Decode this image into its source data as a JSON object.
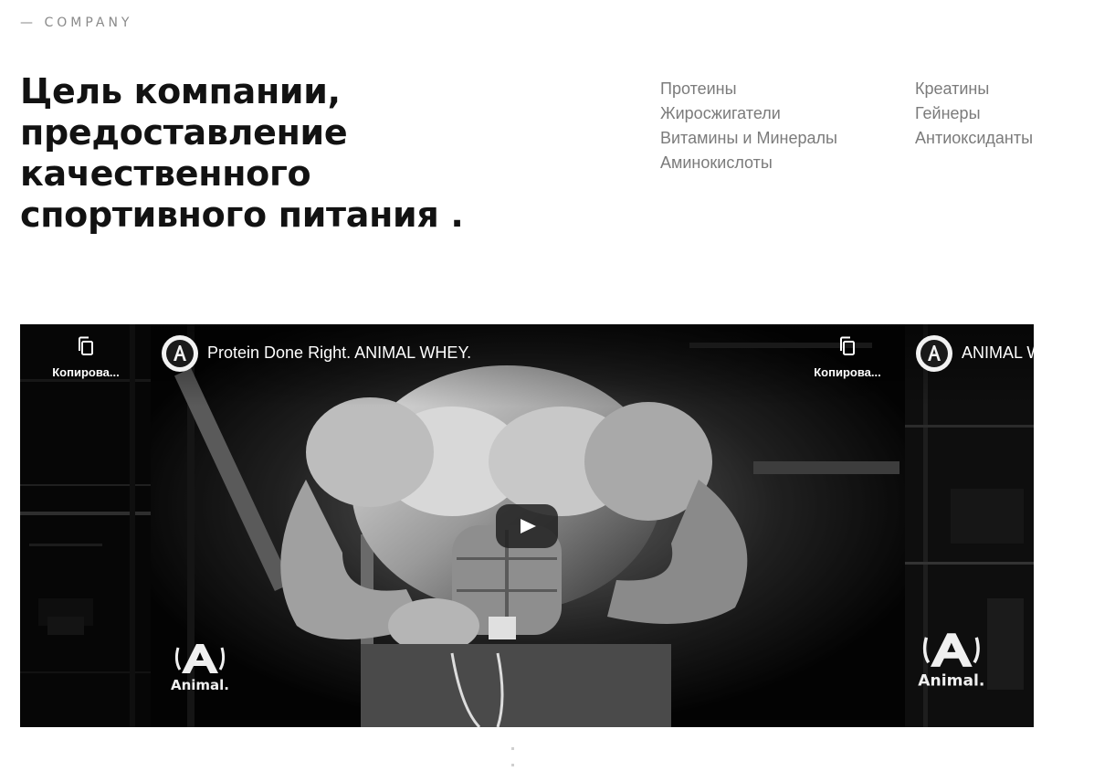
{
  "eyebrow": "— COMPANY",
  "headline": {
    "line1": "Цель компании,",
    "line2": "предоставление",
    "line3": "качественного",
    "line4": "спортивного питания ."
  },
  "categories": {
    "col1": [
      "Протеины",
      "Жиросжигатели",
      "Витамины и Минералы",
      "Аминокислоты"
    ],
    "col2": [
      "Креатины",
      "Гейнеры",
      "Антиоксиданты"
    ]
  },
  "video_carousel": {
    "slides": [
      {
        "copy_label": "Копирова...",
        "icons": [
          "copy-icon"
        ]
      },
      {
        "channel_logo": "Animal",
        "title": "Protein Done Right. ANIMAL WHEY.",
        "watermark": "Animal.",
        "icons": [
          "animal-logo-icon",
          "play-icon"
        ]
      },
      {
        "channel_logo": "Animal",
        "title": "ANIMAL W",
        "copy_label": "Копирова...",
        "watermark": "Animal.",
        "icons": [
          "animal-logo-icon",
          "copy-icon"
        ]
      }
    ]
  },
  "colors": {
    "background": "#ffffff",
    "headline": "#121212",
    "category_link": "#7b7b7b",
    "video_bg": "#050505",
    "play_button": "#212121"
  }
}
